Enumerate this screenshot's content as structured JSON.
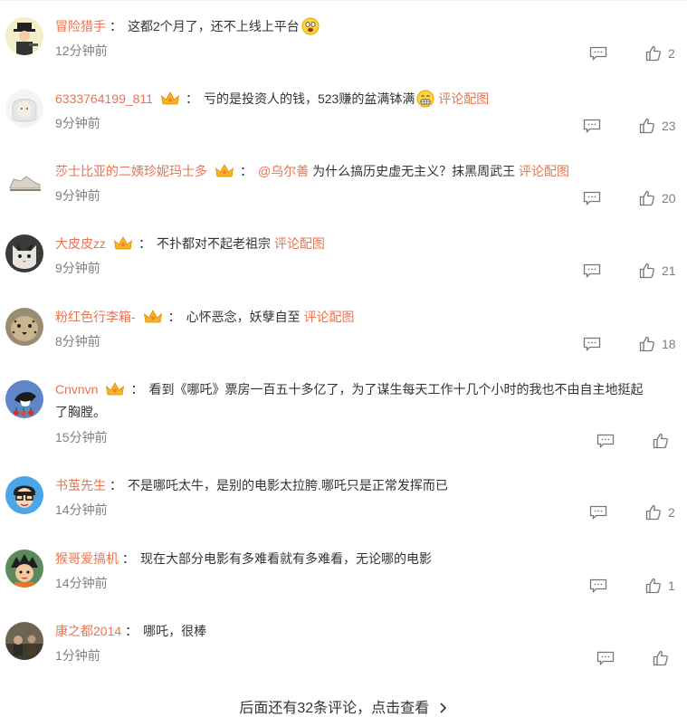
{
  "comments": [
    {
      "username": "冒险猎手",
      "text": "这都2个月了，还不上线上平台",
      "time": "12分钟前",
      "likes": "2",
      "avatar_icon": "cartoon-gunman-avatar"
    },
    {
      "username": "6333764199_811",
      "text": "亏的是投资人的钱，523赚的盆满钵满",
      "link": "评论配图",
      "time": "9分钟前",
      "likes": "23",
      "avatar_icon": "white-haired-figure-avatar"
    },
    {
      "username": "莎士比亚的二姨珍妮玛士多",
      "mention": "@乌尔善",
      "text": "为什么搞历史虚无主义？抹黑周武王",
      "link": "评论配图",
      "time": "9分钟前",
      "likes": "20",
      "avatar_icon": "sneaker-avatar"
    },
    {
      "username": "大皮皮zz",
      "text": "不扑都对不起老祖宗",
      "link": "评论配图",
      "time": "9分钟前",
      "likes": "21",
      "avatar_icon": "cat-avatar"
    },
    {
      "username": "粉红色行李箱-",
      "text": "心怀恶念，妖孽自至",
      "link": "评论配图",
      "time": "8分钟前",
      "likes": "18",
      "avatar_icon": "cheetah-avatar"
    },
    {
      "username": "Cnvnvn",
      "text": "看到《哪吒》票房一百五十多亿了，为了谋生每天工作十几个小时的我也不由自主地挺起",
      "text2": "了胸膛。",
      "time": "15分钟前",
      "likes": "",
      "avatar_icon": "magpie-avatar"
    },
    {
      "username": "书茧先生",
      "text": "不是哪吒太牛，是别的电影太拉胯.哪吒只是正常发挥而已",
      "time": "14分钟前",
      "likes": "2",
      "avatar_icon": "glasses-cartoon-avatar"
    },
    {
      "username": "猴哥爱搞机",
      "text": "现在大部分电影有多难看就有多难看，无论哪的电影",
      "time": "14分钟前",
      "likes": "1",
      "avatar_icon": "anime-boy-avatar"
    },
    {
      "username": "康之都2014",
      "text": "哪吒，很棒",
      "time": "1分钟前",
      "likes": "",
      "avatar_icon": "photo-avatar"
    }
  ],
  "footer": {
    "more_text": "后面还有32条评论，点击查看",
    "chevron": "chevron-right-icon"
  },
  "colors": {
    "username": "#eb7350",
    "text": "#333333",
    "meta": "#808080",
    "crown": "#f5a623"
  }
}
